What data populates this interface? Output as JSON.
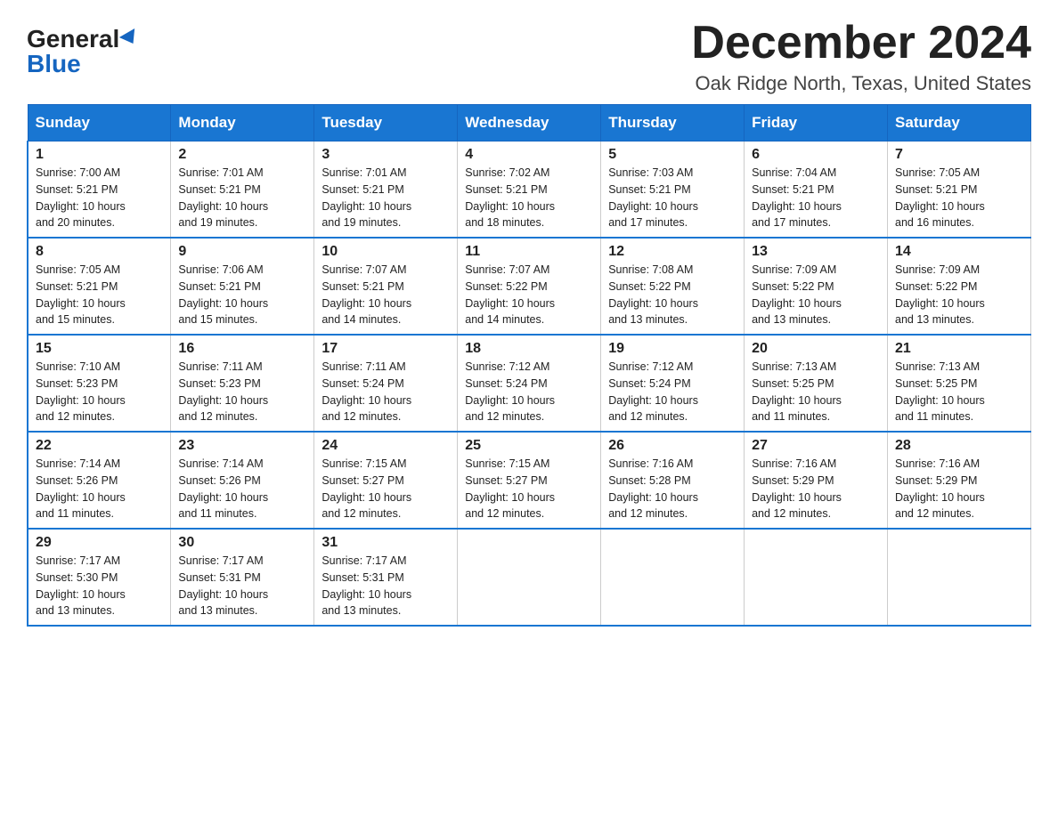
{
  "header": {
    "logo_general": "General",
    "logo_blue": "Blue",
    "month": "December 2024",
    "location": "Oak Ridge North, Texas, United States"
  },
  "weekdays": [
    "Sunday",
    "Monday",
    "Tuesday",
    "Wednesday",
    "Thursday",
    "Friday",
    "Saturday"
  ],
  "weeks": [
    [
      {
        "day": "1",
        "sunrise": "7:00 AM",
        "sunset": "5:21 PM",
        "daylight": "10 hours and 20 minutes."
      },
      {
        "day": "2",
        "sunrise": "7:01 AM",
        "sunset": "5:21 PM",
        "daylight": "10 hours and 19 minutes."
      },
      {
        "day": "3",
        "sunrise": "7:01 AM",
        "sunset": "5:21 PM",
        "daylight": "10 hours and 19 minutes."
      },
      {
        "day": "4",
        "sunrise": "7:02 AM",
        "sunset": "5:21 PM",
        "daylight": "10 hours and 18 minutes."
      },
      {
        "day": "5",
        "sunrise": "7:03 AM",
        "sunset": "5:21 PM",
        "daylight": "10 hours and 17 minutes."
      },
      {
        "day": "6",
        "sunrise": "7:04 AM",
        "sunset": "5:21 PM",
        "daylight": "10 hours and 17 minutes."
      },
      {
        "day": "7",
        "sunrise": "7:05 AM",
        "sunset": "5:21 PM",
        "daylight": "10 hours and 16 minutes."
      }
    ],
    [
      {
        "day": "8",
        "sunrise": "7:05 AM",
        "sunset": "5:21 PM",
        "daylight": "10 hours and 15 minutes."
      },
      {
        "day": "9",
        "sunrise": "7:06 AM",
        "sunset": "5:21 PM",
        "daylight": "10 hours and 15 minutes."
      },
      {
        "day": "10",
        "sunrise": "7:07 AM",
        "sunset": "5:21 PM",
        "daylight": "10 hours and 14 minutes."
      },
      {
        "day": "11",
        "sunrise": "7:07 AM",
        "sunset": "5:22 PM",
        "daylight": "10 hours and 14 minutes."
      },
      {
        "day": "12",
        "sunrise": "7:08 AM",
        "sunset": "5:22 PM",
        "daylight": "10 hours and 13 minutes."
      },
      {
        "day": "13",
        "sunrise": "7:09 AM",
        "sunset": "5:22 PM",
        "daylight": "10 hours and 13 minutes."
      },
      {
        "day": "14",
        "sunrise": "7:09 AM",
        "sunset": "5:22 PM",
        "daylight": "10 hours and 13 minutes."
      }
    ],
    [
      {
        "day": "15",
        "sunrise": "7:10 AM",
        "sunset": "5:23 PM",
        "daylight": "10 hours and 12 minutes."
      },
      {
        "day": "16",
        "sunrise": "7:11 AM",
        "sunset": "5:23 PM",
        "daylight": "10 hours and 12 minutes."
      },
      {
        "day": "17",
        "sunrise": "7:11 AM",
        "sunset": "5:24 PM",
        "daylight": "10 hours and 12 minutes."
      },
      {
        "day": "18",
        "sunrise": "7:12 AM",
        "sunset": "5:24 PM",
        "daylight": "10 hours and 12 minutes."
      },
      {
        "day": "19",
        "sunrise": "7:12 AM",
        "sunset": "5:24 PM",
        "daylight": "10 hours and 12 minutes."
      },
      {
        "day": "20",
        "sunrise": "7:13 AM",
        "sunset": "5:25 PM",
        "daylight": "10 hours and 11 minutes."
      },
      {
        "day": "21",
        "sunrise": "7:13 AM",
        "sunset": "5:25 PM",
        "daylight": "10 hours and 11 minutes."
      }
    ],
    [
      {
        "day": "22",
        "sunrise": "7:14 AM",
        "sunset": "5:26 PM",
        "daylight": "10 hours and 11 minutes."
      },
      {
        "day": "23",
        "sunrise": "7:14 AM",
        "sunset": "5:26 PM",
        "daylight": "10 hours and 11 minutes."
      },
      {
        "day": "24",
        "sunrise": "7:15 AM",
        "sunset": "5:27 PM",
        "daylight": "10 hours and 12 minutes."
      },
      {
        "day": "25",
        "sunrise": "7:15 AM",
        "sunset": "5:27 PM",
        "daylight": "10 hours and 12 minutes."
      },
      {
        "day": "26",
        "sunrise": "7:16 AM",
        "sunset": "5:28 PM",
        "daylight": "10 hours and 12 minutes."
      },
      {
        "day": "27",
        "sunrise": "7:16 AM",
        "sunset": "5:29 PM",
        "daylight": "10 hours and 12 minutes."
      },
      {
        "day": "28",
        "sunrise": "7:16 AM",
        "sunset": "5:29 PM",
        "daylight": "10 hours and 12 minutes."
      }
    ],
    [
      {
        "day": "29",
        "sunrise": "7:17 AM",
        "sunset": "5:30 PM",
        "daylight": "10 hours and 13 minutes."
      },
      {
        "day": "30",
        "sunrise": "7:17 AM",
        "sunset": "5:31 PM",
        "daylight": "10 hours and 13 minutes."
      },
      {
        "day": "31",
        "sunrise": "7:17 AM",
        "sunset": "5:31 PM",
        "daylight": "10 hours and 13 minutes."
      },
      null,
      null,
      null,
      null
    ]
  ],
  "labels": {
    "sunrise": "Sunrise:",
    "sunset": "Sunset:",
    "daylight": "Daylight:"
  }
}
